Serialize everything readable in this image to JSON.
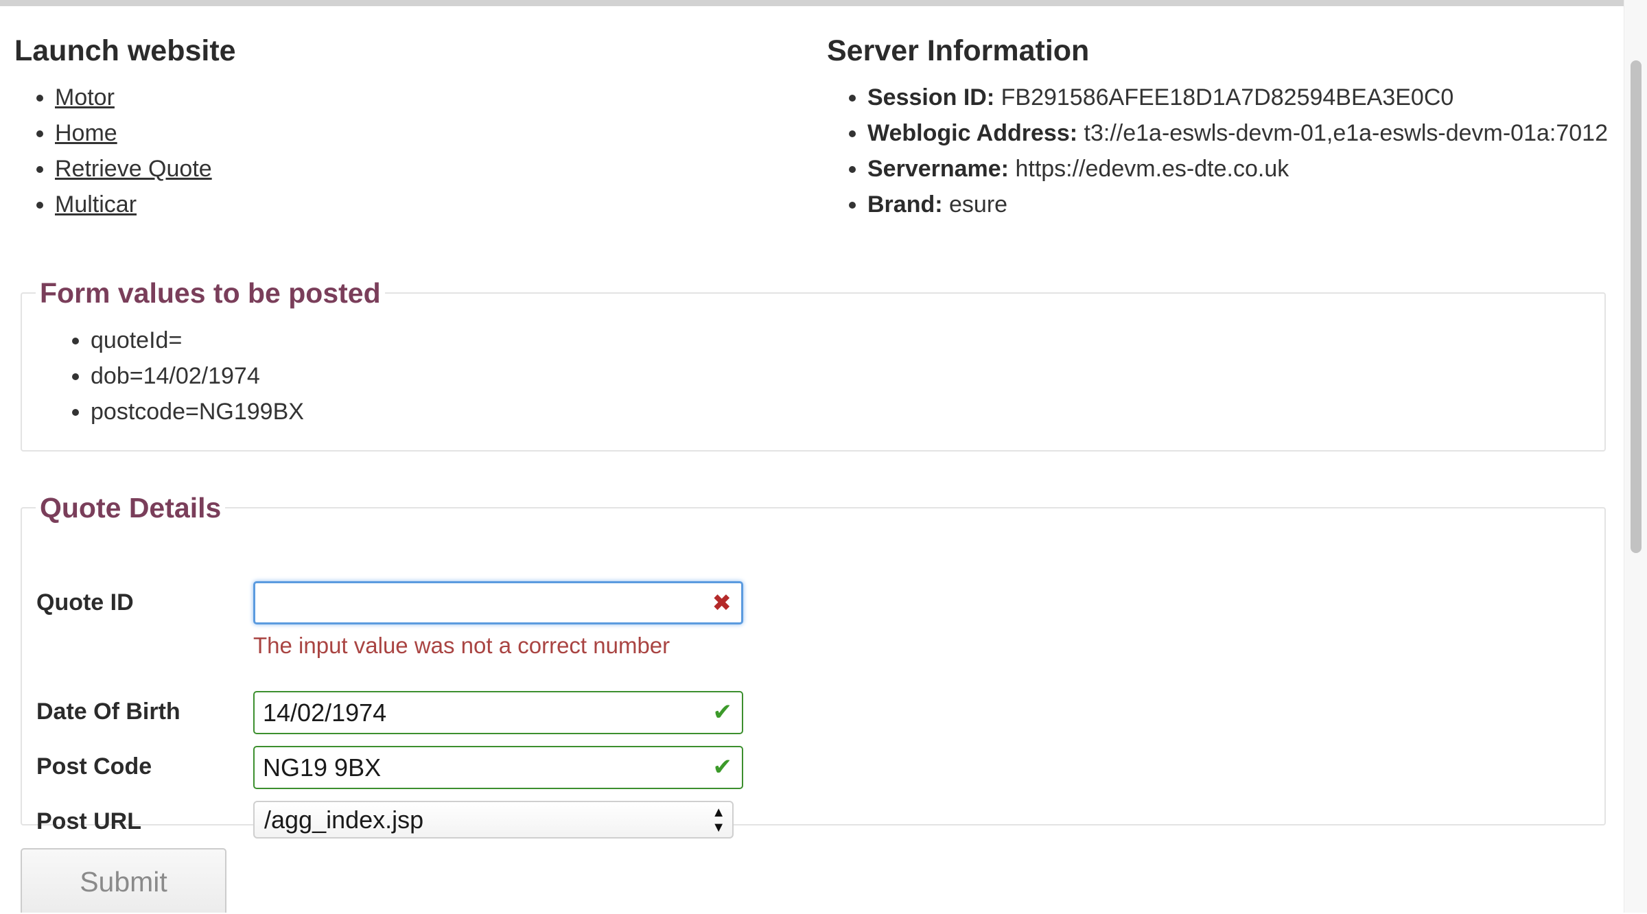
{
  "launch": {
    "heading": "Launch website",
    "links": [
      "Motor",
      "Home",
      "Retrieve Quote",
      "Multicar"
    ]
  },
  "server": {
    "heading": "Server Information",
    "items": [
      {
        "label": "Session ID:",
        "value": "FB291586AFEE18D1A7D82594BEA3E0C0"
      },
      {
        "label": "Weblogic Address:",
        "value": "t3://e1a-eswls-devm-01,e1a-eswls-devm-01a:7012"
      },
      {
        "label": "Servername:",
        "value": "https://edevm.es-dte.co.uk"
      },
      {
        "label": "Brand:",
        "value": "esure"
      }
    ]
  },
  "posted": {
    "legend": "Form values to be posted",
    "items": [
      "quoteId=",
      "dob=14/02/1974",
      "postcode=NG199BX"
    ]
  },
  "quote": {
    "legend": "Quote Details",
    "quote_id": {
      "label": "Quote ID",
      "value": "",
      "status": "error",
      "error": "The input value was not a correct number"
    },
    "dob": {
      "label": "Date Of Birth",
      "value": "14/02/1974",
      "status": "valid"
    },
    "postcode": {
      "label": "Post Code",
      "value": "NG19 9BX",
      "status": "valid"
    },
    "post_url": {
      "label": "Post URL",
      "selected": "/agg_index.jsp"
    }
  },
  "submit_label": "Submit",
  "colors": {
    "legend": "#7a3e5a",
    "error": "#a94442",
    "valid_border": "#3c8f2e",
    "focus_border": "#5b9bdf"
  },
  "icons": {
    "error": "x-icon",
    "valid": "check-icon"
  }
}
